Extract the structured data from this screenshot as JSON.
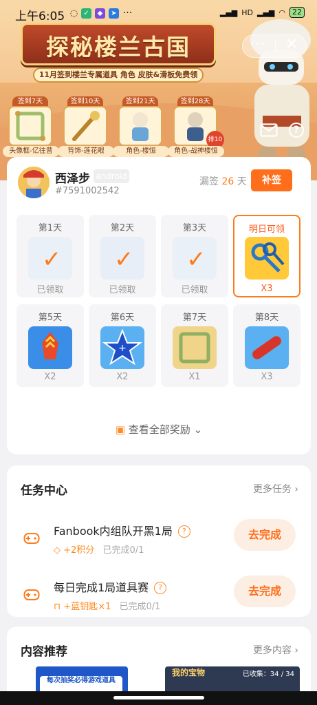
{
  "status": {
    "time": "上午6:05",
    "network": "HD",
    "battery": "22"
  },
  "banner": {
    "title": "探秘楼兰古国",
    "subtitle": "11月签到楼兰专属道具  角色 皮肤&滑板免费领",
    "rewards": [
      {
        "tag": "签到7天",
        "name": "头像框-亿往昔"
      },
      {
        "tag": "签到10天",
        "name": "背饰-莲花眼"
      },
      {
        "tag": "签到21天",
        "name": "角色-楼恒"
      },
      {
        "tag": "签到28天",
        "name": "角色-战神楼恒",
        "badge": "排10的"
      }
    ]
  },
  "user": {
    "name": "西泽步",
    "platform": "android",
    "id": "#7591002542",
    "missed_prefix": "漏签",
    "missed_days": "26",
    "missed_suffix": "天",
    "makeup_label": "补签"
  },
  "days": [
    {
      "label": "第1天",
      "qty": "已领取",
      "state": "claimed",
      "icon": "frame-icon"
    },
    {
      "label": "第2天",
      "qty": "已领取",
      "state": "claimed",
      "icon": "star-icon"
    },
    {
      "label": "第3天",
      "qty": "已领取",
      "state": "claimed",
      "icon": "feather-icon"
    },
    {
      "label": "明日可领",
      "qty": "X3",
      "state": "tomorrow",
      "icon": "keys-icon"
    },
    {
      "label": "第5天",
      "qty": "X2",
      "state": "future",
      "icon": "rocket-icon"
    },
    {
      "label": "第6天",
      "qty": "X2",
      "state": "future",
      "icon": "star-icon"
    },
    {
      "label": "第7天",
      "qty": "X1",
      "state": "future",
      "icon": "frame-icon"
    },
    {
      "label": "第8天",
      "qty": "X3",
      "state": "future",
      "icon": "skateboard-icon"
    }
  ],
  "view_all_label": "查看全部奖励",
  "tasks": {
    "title": "任务中心",
    "more": "更多任务",
    "items": [
      {
        "title": "Fanbook内组队开黑1局",
        "reward": "+2积分",
        "progress": "已完成0/1",
        "button": "去完成"
      },
      {
        "title": "每日完成1局道具赛",
        "reward": "+蓝钥匙×1",
        "progress": "已完成0/1",
        "button": "去完成"
      }
    ]
  },
  "recommend": {
    "title": "内容推荐",
    "more": "更多内容",
    "thumb1_text": "每次抽奖必得游戏道具",
    "thumb2_title": "我的宝物",
    "thumb2_count": "已收集：34 / 34"
  },
  "colors": {
    "accent": "#ff6e1a",
    "card_bg": "#ffffff",
    "page_bg": "#f2f2f4"
  }
}
